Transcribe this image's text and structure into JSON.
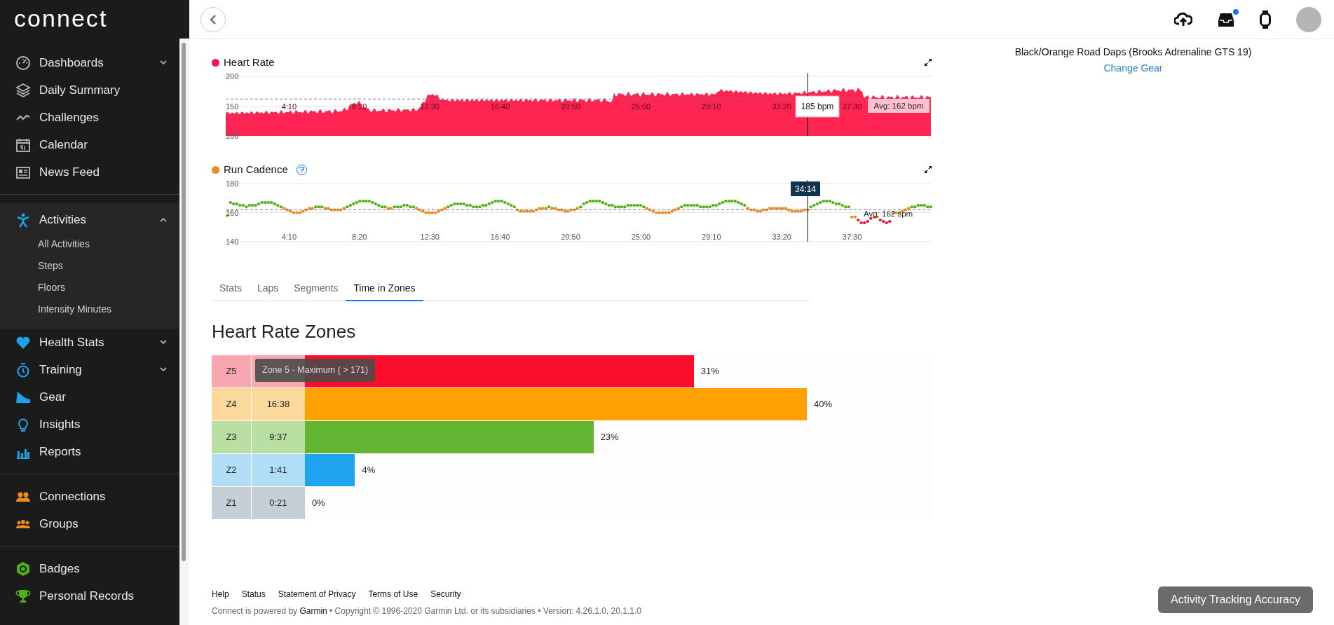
{
  "sidebar": {
    "logo": "connect",
    "sections": [
      {
        "items": [
          {
            "label": "Dashboards",
            "kind": "menu",
            "expanded": false
          },
          {
            "label": "Daily Summary",
            "kind": "link"
          },
          {
            "label": "Challenges",
            "kind": "link"
          },
          {
            "label": "Calendar",
            "kind": "link"
          },
          {
            "label": "News Feed",
            "kind": "link"
          }
        ]
      },
      {
        "items": [
          {
            "label": "Activities",
            "kind": "menu",
            "expanded": true,
            "children": [
              {
                "label": "All Activities"
              },
              {
                "label": "Steps"
              },
              {
                "label": "Floors"
              },
              {
                "label": "Intensity Minutes"
              }
            ]
          },
          {
            "label": "Health Stats",
            "kind": "menu",
            "expanded": false
          },
          {
            "label": "Training",
            "kind": "menu",
            "expanded": false
          },
          {
            "label": "Gear",
            "kind": "link"
          },
          {
            "label": "Insights",
            "kind": "link"
          },
          {
            "label": "Reports",
            "kind": "link"
          }
        ]
      },
      {
        "items": [
          {
            "label": "Connections",
            "kind": "link"
          },
          {
            "label": "Groups",
            "kind": "link"
          }
        ]
      },
      {
        "items": [
          {
            "label": "Badges",
            "kind": "link"
          },
          {
            "label": "Personal Records",
            "kind": "link"
          }
        ]
      }
    ]
  },
  "header": {
    "inbox_unread": true
  },
  "charts": [
    {
      "title": "Heart Rate",
      "y_labels": [
        "200",
        "150",
        "100"
      ],
      "x_labels": [
        "4:10",
        "8:20",
        "12:30",
        "16:40",
        "20:50",
        "25:00",
        "29:10",
        "33:20",
        "37:30"
      ],
      "tooltip": "185 bpm",
      "average": "Avg: 162 bpm"
    },
    {
      "title": "Run Cadence",
      "y_labels": [
        "180",
        "160",
        "140"
      ],
      "x_labels": [
        "4:10",
        "8:20",
        "12:30",
        "16:40",
        "20:50",
        "25:00",
        "29:10",
        "33:20",
        "37:30"
      ],
      "tooltip": "34:14",
      "average": "Avg: 162 spm",
      "help": true
    }
  ],
  "tabs": [
    {
      "label": "Stats",
      "selected": false
    },
    {
      "label": "Laps",
      "selected": false
    },
    {
      "label": "Segments",
      "selected": false
    },
    {
      "label": "Time in Zones",
      "selected": true
    }
  ],
  "zones": {
    "title": "Heart Rate Zones",
    "tooltip": "Zone 5 - Maximum ( > 171)",
    "rows": [
      {
        "zone": "Z5",
        "level": 0.62,
        "percent": "31%",
        "color": "#f9a8b2"
      },
      {
        "zone": "Z4",
        "time": "16:38",
        "level": 0.8,
        "percent": "40%",
        "color": "#fbd89c"
      },
      {
        "zone": "Z3",
        "time": "9:37",
        "level": 0.46,
        "percent": "23%",
        "color": "#b9e0a2"
      },
      {
        "zone": "Z2",
        "time": "1:41",
        "level": 0.08,
        "percent": "4%",
        "color": "#b1ddf6"
      },
      {
        "zone": "Z1",
        "time": "0:21",
        "percent": "0%",
        "color": "#c6ced6"
      }
    ]
  },
  "gear": {
    "name": "Black/Orange Road Daps (Brooks Adrenaline GTS 19)",
    "link": "Change Gear"
  },
  "footer": {
    "links": [
      "Help",
      "Status",
      "Statement of Privacy",
      "Terms of Use",
      "Security"
    ],
    "copyright": "Connect is powered by **Garmin** • Copyright © 1996-2020 Garmin Ltd. or its subsidiaries • Version: 4.26.1.0, 20.1.1.0"
  },
  "accuracy_button": "Activity Tracking Accuracy"
}
